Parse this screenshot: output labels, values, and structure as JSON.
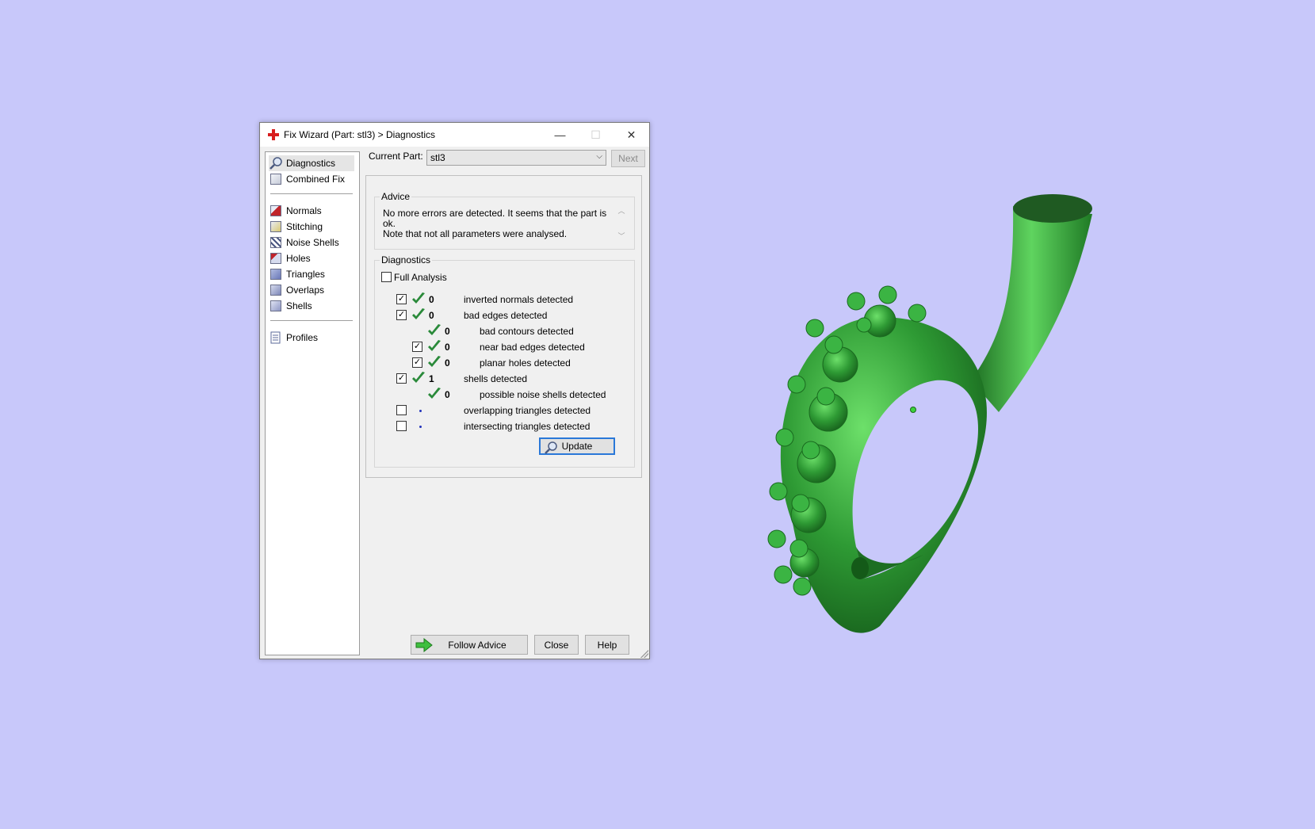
{
  "window": {
    "title": "Fix Wizard (Part: stl3) > Diagnostics",
    "minimize": "—",
    "maximize": "☐",
    "close": "✕"
  },
  "sidebar": {
    "items": [
      {
        "label": "Diagnostics",
        "icon": "magnifier-icon",
        "selected": true
      },
      {
        "label": "Combined Fix",
        "icon": "combined-fix-icon"
      },
      {
        "label": "Normals",
        "icon": "normals-icon"
      },
      {
        "label": "Stitching",
        "icon": "stitching-icon"
      },
      {
        "label": "Noise Shells",
        "icon": "noise-shells-icon"
      },
      {
        "label": "Holes",
        "icon": "holes-icon"
      },
      {
        "label": "Triangles",
        "icon": "triangles-icon"
      },
      {
        "label": "Overlaps",
        "icon": "overlaps-icon"
      },
      {
        "label": "Shells",
        "icon": "shells-icon"
      },
      {
        "label": "Profiles",
        "icon": "profiles-icon"
      }
    ]
  },
  "current_part": {
    "label": "Current Part:",
    "value": "stl3",
    "next_label": "Next"
  },
  "advice": {
    "title": "Advice",
    "text_line1": "No more errors are detected. It seems that the part is ok.",
    "text_line2": "Note that not all parameters were analysed."
  },
  "diagnostics": {
    "title": "Diagnostics",
    "full_analysis_label": "Full Analysis",
    "rows": [
      {
        "checked": true,
        "status": "ok",
        "count": "0",
        "label": "inverted normals detected"
      },
      {
        "checked": true,
        "status": "ok",
        "count": "0",
        "label": "bad edges detected"
      },
      {
        "checked": null,
        "status": "ok",
        "count": "0",
        "label": "bad contours detected"
      },
      {
        "checked": true,
        "status": "ok",
        "count": "0",
        "label": "near bad edges detected"
      },
      {
        "checked": true,
        "status": "ok",
        "count": "0",
        "label": "planar holes detected"
      },
      {
        "checked": true,
        "status": "ok",
        "count": "1",
        "label": "shells detected"
      },
      {
        "checked": null,
        "status": "ok",
        "count": "0",
        "label": "possible noise shells detected"
      },
      {
        "checked": false,
        "status": "pending",
        "count": "",
        "label": "overlapping triangles detected"
      },
      {
        "checked": false,
        "status": "pending",
        "count": "",
        "label": "intersecting triangles detected"
      }
    ],
    "update_label": "Update"
  },
  "footer": {
    "follow_advice_label": "Follow Advice",
    "close_label": "Close",
    "help_label": "Help"
  },
  "colors": {
    "background": "#c8c8fa",
    "model_green": "#2e9a34",
    "check_green": "#2a8a3a",
    "accent_blue": "#2a78d8"
  }
}
